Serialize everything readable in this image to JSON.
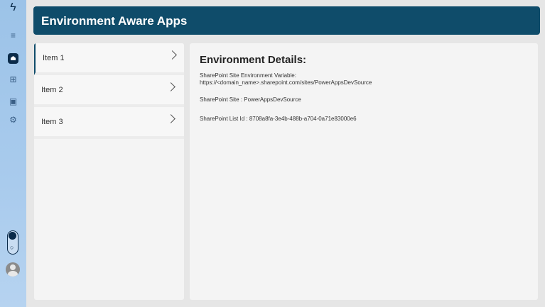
{
  "sidebar": {
    "icons": [
      "lightning-icon",
      "menu-icon",
      "home-icon",
      "add-icon",
      "calendar-icon",
      "settings-icon"
    ]
  },
  "header": {
    "title": "Environment Aware Apps"
  },
  "list": {
    "items": [
      {
        "label": "Item 1"
      },
      {
        "label": "Item 2"
      },
      {
        "label": "Item 3"
      }
    ]
  },
  "details": {
    "heading": "Environment Details:",
    "env_label": "SharePoint Site Environment Variable:",
    "env_value": "https://<domain_name>.sharepoint.com/sites/PowerAppsDevSource",
    "site": "SharePoint Site : PowerAppsDevSource",
    "list_id": "SharePoint List Id : 8708a8fa-3e4b-488b-a704-0a71e83000e6"
  },
  "colors": {
    "header_bg": "#0f4c6a",
    "rail_bg": "#a9cbed"
  }
}
